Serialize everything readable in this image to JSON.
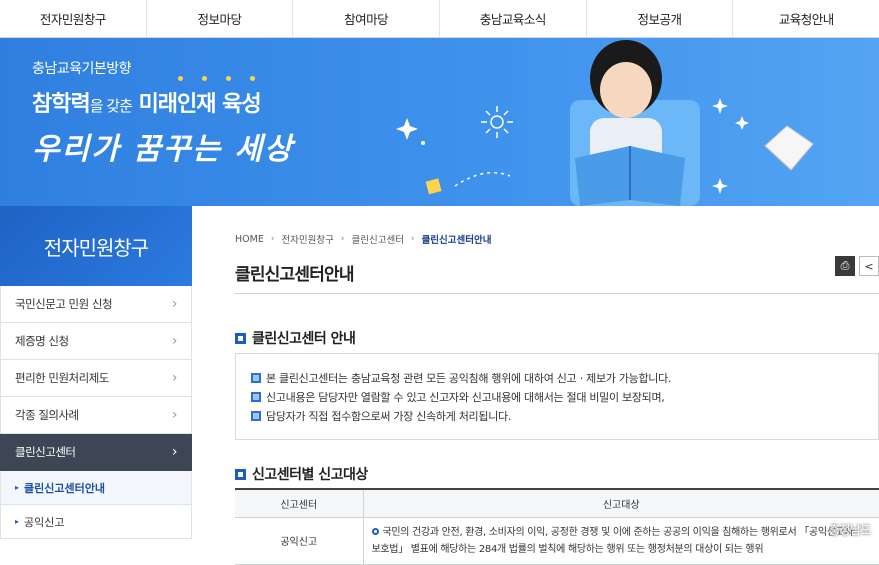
{
  "topnav": [
    "전자민원창구",
    "정보마당",
    "참여마당",
    "충남교육소식",
    "정보공개",
    "교육청안내"
  ],
  "banner": {
    "subtitle": "충남교육기본방향",
    "main_part1": "참학력",
    "main_small": "을 갖춘",
    "main_part2": " 미래인재 육성",
    "slogan": "우리가 꿈꾸는 세상"
  },
  "sidebar": {
    "title": "전자민원창구",
    "items": [
      {
        "label": "국민신문고 민원 신청"
      },
      {
        "label": "제증명 신청"
      },
      {
        "label": "편리한 민원처리제도"
      },
      {
        "label": "각종 질의사례"
      },
      {
        "label": "클린신고센터"
      }
    ],
    "subitems": [
      {
        "label": "클린신고센터안내"
      },
      {
        "label": "공익신고"
      }
    ]
  },
  "breadcrumb": [
    "HOME",
    "전자민원창구",
    "클린신고센터",
    "클린신고센터안내"
  ],
  "page_title": "클린신고센터안내",
  "section1": {
    "title": "클린신고센터 안내",
    "lines": [
      "본 클린신고센터는 충남교육청 관련 모든 공익침해 행위에 대하여 신고ㆍ제보가 가능합니다.",
      "신고내용은 담당자만 열람할 수 있고 신고자와 신고내용에 대해서는 절대 비밀이 보장되며,",
      "담당자가 직접 접수함으로써 가장 신속하게 처리됩니다."
    ]
  },
  "section2": {
    "title": "신고센터별 신고대상",
    "headers": [
      "신고센터",
      "신고대상"
    ],
    "rows": [
      {
        "center": "공익신고",
        "line1": "국민의 건강과 안전, 환경, 소비자의 이익, 공정한 경쟁 및 이에 준하는 공공의 이익을 침해하는 행위로서 「공익신고자",
        "line2": "보호법」 별표에 해당하는 284개 법률의 벌칙에 해당하는 행위 또는 행정처분의 대상이 되는 행위"
      }
    ]
  },
  "watermark": "충청남도",
  "colors": {
    "accent": "#1d5cbf",
    "banner": "#3f92ec",
    "sidebar_active": "#3c4654"
  }
}
